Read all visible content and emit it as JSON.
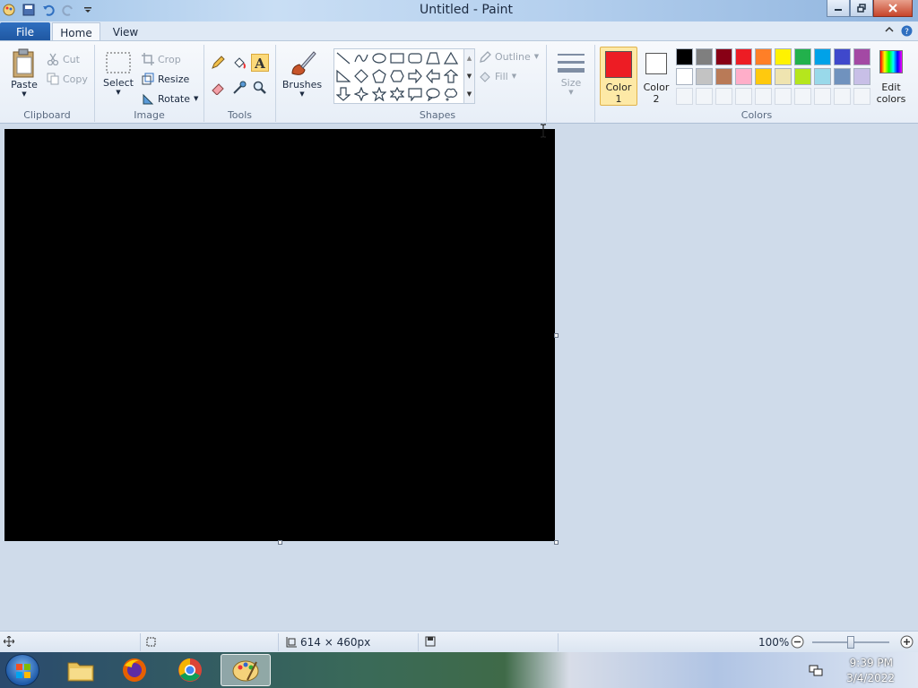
{
  "window": {
    "title": "Untitled - Paint"
  },
  "tabs": {
    "file": "File",
    "home": "Home",
    "view": "View"
  },
  "ribbon": {
    "clipboard": {
      "label": "Clipboard",
      "paste": "Paste",
      "cut": "Cut",
      "copy": "Copy"
    },
    "image": {
      "label": "Image",
      "select": "Select",
      "crop": "Crop",
      "resize": "Resize",
      "rotate": "Rotate"
    },
    "tools": {
      "label": "Tools"
    },
    "brushes": {
      "label": "Brushes"
    },
    "shapes": {
      "label": "Shapes",
      "outline": "Outline",
      "fill": "Fill"
    },
    "size": {
      "label": "Size"
    },
    "colors": {
      "label": "Colors",
      "color1_line1": "Color",
      "color1_line2": "1",
      "color2_line1": "Color",
      "color2_line2": "2",
      "edit_line1": "Edit",
      "edit_line2": "colors",
      "color1_value": "#ed1c24",
      "color2_value": "#ffffff",
      "palette_row1": [
        "#000000",
        "#7f7f7f",
        "#880015",
        "#ed1c24",
        "#ff7f27",
        "#fff200",
        "#22b14c",
        "#00a2e8",
        "#3f48cc",
        "#a349a4"
      ],
      "palette_row2": [
        "#ffffff",
        "#c3c3c3",
        "#b97a57",
        "#ffaec9",
        "#ffc90e",
        "#efe4b0",
        "#b5e61d",
        "#99d9ea",
        "#7092be",
        "#c8bfe7"
      ]
    }
  },
  "canvas": {
    "fill": "#000000"
  },
  "status": {
    "dimensions": "614 × 460px",
    "zoom": "100%",
    "zoom_level_percent": 100
  },
  "taskbar": {
    "time": "9:39 PM",
    "date": "3/4/2022"
  }
}
